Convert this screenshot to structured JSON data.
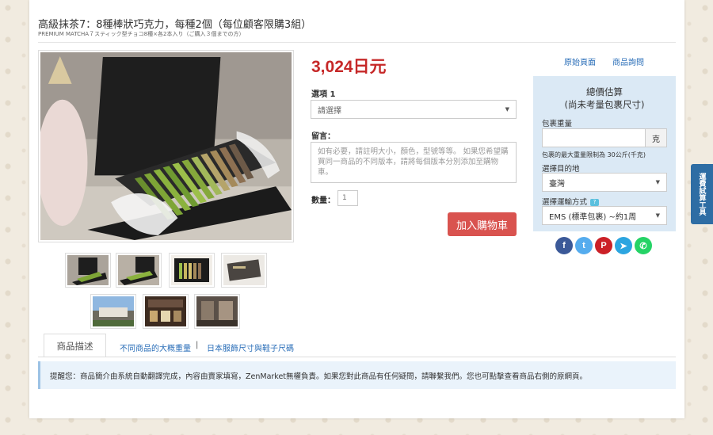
{
  "product": {
    "title": "高級抹茶7：8種棒狀巧克力，每種2個（每位顧客限購3組）",
    "subtitle": "PREMIUM MATCHA７スティック型チョコ8種×各2本入り（ご購入３個までの方）",
    "price": "3,024日元"
  },
  "options": {
    "option_label": "選項 1",
    "select_placeholder": "請選擇",
    "message_label": "留言：",
    "message_placeholder": "如有必要，請註明大小，顏色，型號等等。 如果您希望購買同一商品的不同版本，請將每個版本分別添加至購物車。",
    "qty_label": "數量：",
    "qty_value": "1",
    "add_to_cart": "加入購物車"
  },
  "links": {
    "original_page": "原始頁面",
    "product_inquiry": "商品詢問"
  },
  "estimate": {
    "title": "總價估算",
    "subtitle": "(尚未考量包裹尺寸)",
    "weight_label": "包裹重量",
    "weight_unit": "克",
    "weight_note": "包裹的最大重量限制為 30公斤(千克)",
    "dest_label": "選擇目的地",
    "dest_value": "臺灣",
    "ship_label": "選擇運輸方式",
    "help_mark": "?",
    "ship_value": "EMS (標準包裹) ~約1周"
  },
  "social": [
    {
      "icon": "facebook-icon",
      "glyph": "f",
      "color": "#3b5998"
    },
    {
      "icon": "twitter-icon",
      "glyph": "t",
      "color": "#55acee"
    },
    {
      "icon": "pinterest-icon",
      "glyph": "P",
      "color": "#cb2027"
    },
    {
      "icon": "telegram-icon",
      "glyph": "➤",
      "color": "#2ca5e0"
    },
    {
      "icon": "whatsapp-icon",
      "glyph": "✆",
      "color": "#25d366"
    }
  ],
  "tabs": {
    "description": "商品描述",
    "weights": "不同商品的大概重量",
    "separator": "|",
    "sizes": "日本服飾尺寸與鞋子尺碼"
  },
  "notice": "提醒您：商品簡介由系統自動翻譯完成，內容由賣家填寫，ZenMarket無權負責。如果您對此商品有任何疑問，請聯繫我們。您也可點擊查看商品右側的原網頁。",
  "side_tab": "運費試算工具",
  "colors": {
    "price": "#c62828",
    "button": "#d9534f",
    "link": "#2a6eb8",
    "estimate_bg": "#dbe9f5",
    "side_tab": "#2e6da4"
  }
}
